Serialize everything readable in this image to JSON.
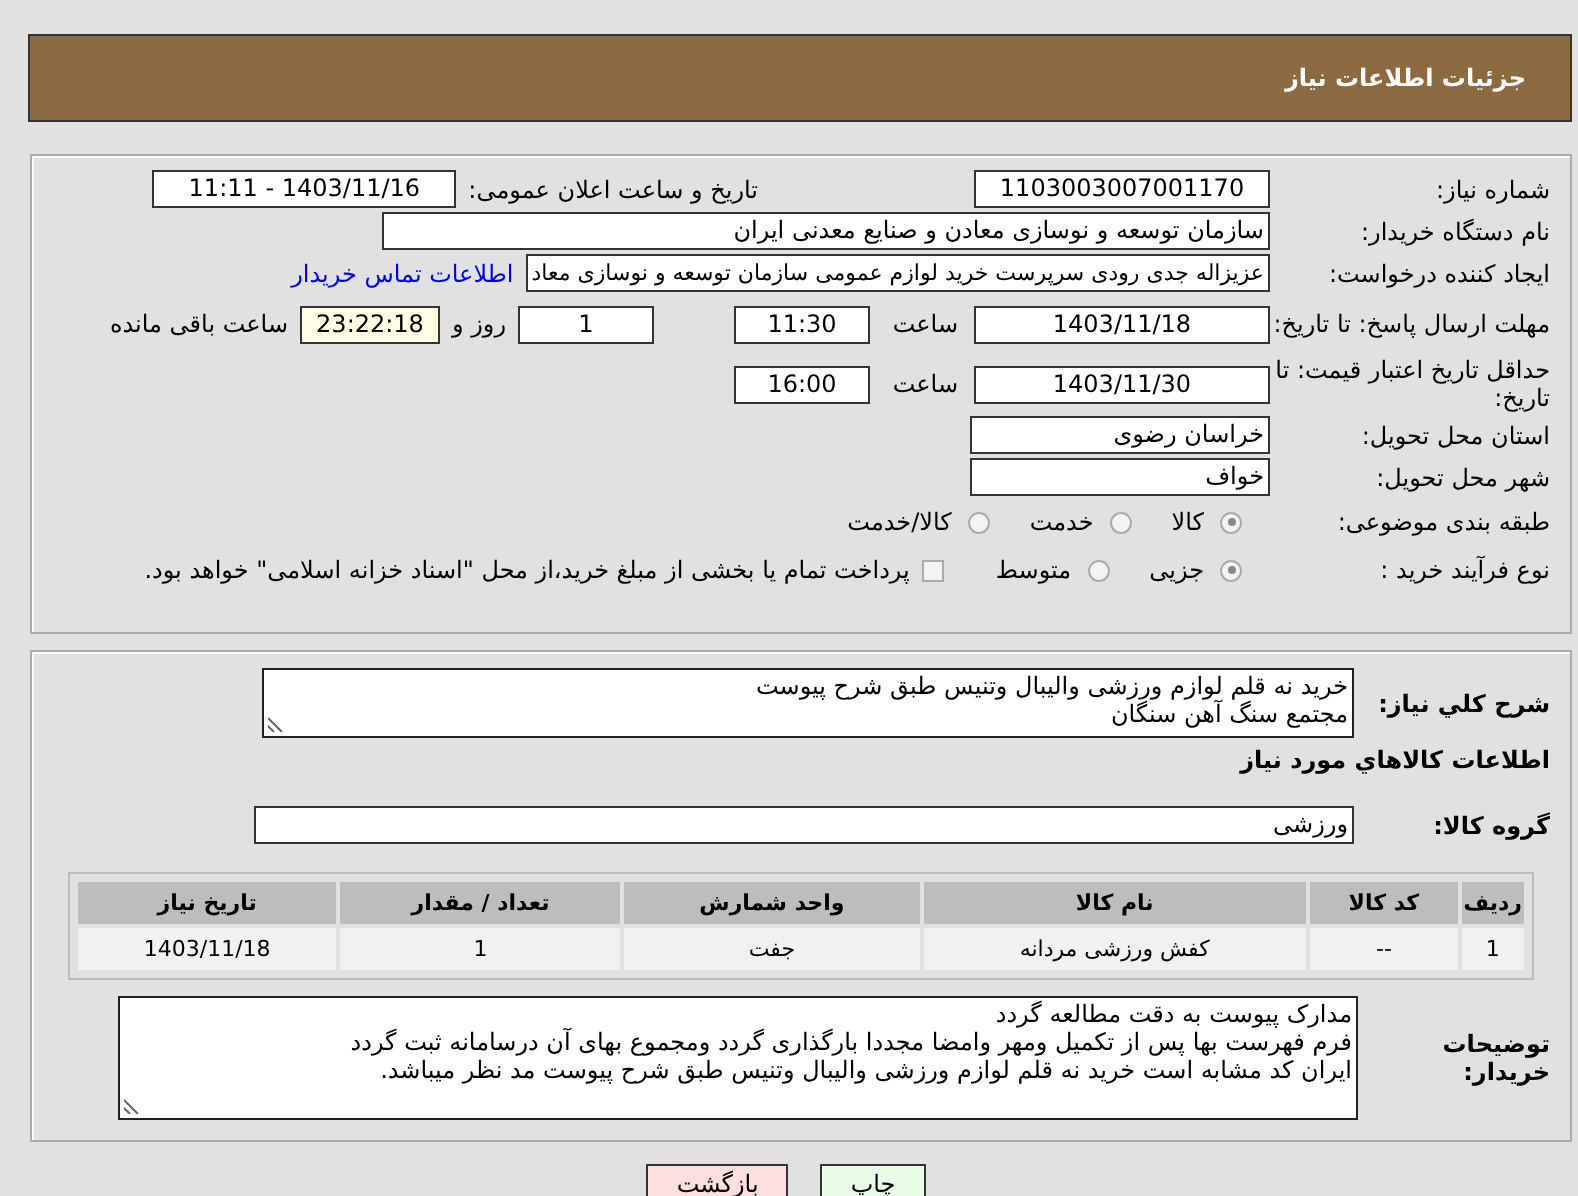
{
  "header": {
    "title": "جزئیات اطلاعات نیاز"
  },
  "details": {
    "need_number": {
      "label": "شماره نیاز:",
      "value": "1103003007001170"
    },
    "announce": {
      "label": "تاریخ و ساعت اعلان عمومی:",
      "value": "1403/11/16 - 11:11"
    },
    "buyer_org": {
      "label": "نام دستگاه خریدار:",
      "value": "سازمان توسعه و نوسازی معادن و صنایع معدنی ایران"
    },
    "requester": {
      "label": "ایجاد کننده درخواست:",
      "value": "عزیزاله جدی رودی سرپرست خرید لوازم عمومی  سازمان توسعه و نوسازی معاد",
      "link": "اطلاعات تماس خریدار"
    },
    "deadline": {
      "label": "مهلت ارسال پاسخ: تا تاریخ:",
      "date": "1403/11/18",
      "time_label": "ساعت",
      "time": "11:30",
      "days": "1",
      "days_label": "روز و",
      "remaining": "23:22:18",
      "remaining_label": "ساعت باقی مانده"
    },
    "validity": {
      "label": "حداقل تاریخ اعتبار قیمت: تا تاریخ:",
      "date": "1403/11/30",
      "time_label": "ساعت",
      "time": "16:00"
    },
    "province": {
      "label": "استان محل تحویل:",
      "value": "خراسان رضوی"
    },
    "city": {
      "label": "شهر محل تحویل:",
      "value": "خواف"
    },
    "category": {
      "label": "طبقه بندی موضوعی:",
      "options": [
        {
          "label": "کالا",
          "selected": true
        },
        {
          "label": "خدمت",
          "selected": false
        },
        {
          "label": "کالا/خدمت",
          "selected": false
        }
      ]
    },
    "process": {
      "label": "نوع فرآیند خرید :",
      "options": [
        {
          "label": "جزیی",
          "selected": true
        },
        {
          "label": "متوسط",
          "selected": false
        }
      ],
      "treasury": {
        "checked": false,
        "text": "پرداخت تمام یا بخشی از مبلغ خرید،از محل \"اسناد خزانه اسلامی\" خواهد بود."
      }
    }
  },
  "summary": {
    "label": "شرح کلي نياز:",
    "value": "خرید نه قلم لوازم ورزشی والیبال وتنیس طبق شرح پیوست\nمجتمع سنگ آهن سنگان"
  },
  "items_heading": "اطلاعات کالاهاي مورد نياز",
  "goods_group": {
    "label": "گروه کالا:",
    "value": "ورزشی"
  },
  "table": {
    "columns": [
      "ردیف",
      "کد کالا",
      "نام کالا",
      "واحد شمارش",
      "تعداد / مقدار",
      "تاریخ نیاز"
    ],
    "rows": [
      [
        "1",
        "--",
        "کفش ورزشی مردانه",
        "جفت",
        "1",
        "1403/11/18"
      ]
    ]
  },
  "buyer_notes": {
    "label": "توضیحات خریدار:",
    "value": "مدارک پیوست به دقت مطالعه گردد\nفرم فهرست بها پس از تکمیل ومهر وامضا مجددا بارگذاری گردد ومجموع بهای آن درسامانه ثبت گردد\nایران کد مشابه است خرید نه قلم لوازم ورزشی والیبال وتنیس طبق شرح پیوست مد نظر میباشد."
  },
  "buttons": [
    {
      "label": "چاپ",
      "kind": "print"
    },
    {
      "label": "بازگشت",
      "kind": "back"
    }
  ]
}
